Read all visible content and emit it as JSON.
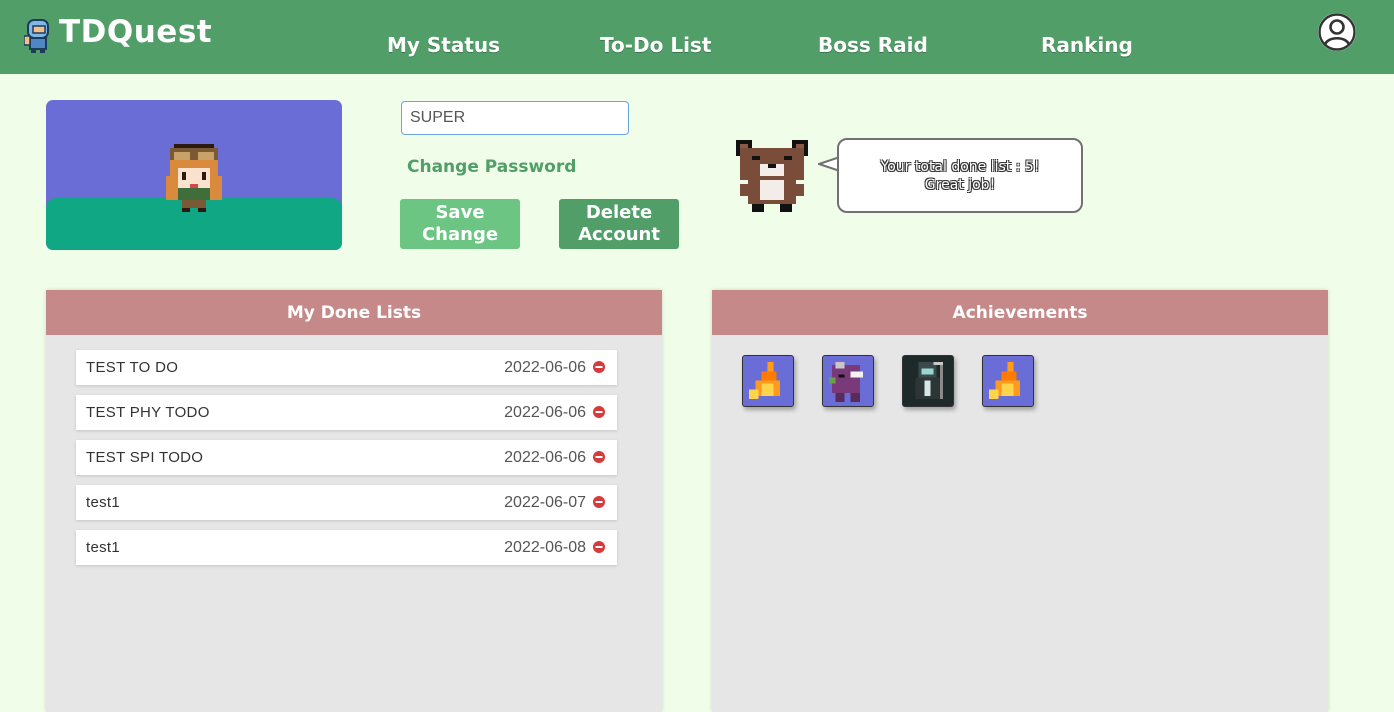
{
  "app": {
    "title": "TDQuest"
  },
  "nav": {
    "items": [
      {
        "label": "My Status"
      },
      {
        "label": "To-Do List"
      },
      {
        "label": "Boss Raid"
      },
      {
        "label": "Ranking"
      }
    ],
    "profile_icon": "user-circle-icon"
  },
  "profile": {
    "nickname_value": "SUPER",
    "change_password_label": "Change Password",
    "save_label": "Save Change",
    "delete_label": "Delete Account"
  },
  "mascot": {
    "message_line1": "Your total done list : 5!",
    "message_line2": "Great job!"
  },
  "done_lists": {
    "header": "My Done Lists",
    "items": [
      {
        "title": "TEST TO DO",
        "date": "2022-06-06"
      },
      {
        "title": "TEST PHY TODO",
        "date": "2022-06-06"
      },
      {
        "title": "TEST SPI TODO",
        "date": "2022-06-06"
      },
      {
        "title": "test1",
        "date": "2022-06-07"
      },
      {
        "title": "test1",
        "date": "2022-06-08"
      }
    ]
  },
  "achievements": {
    "header": "Achievements",
    "badges": [
      {
        "icon": "fire-badge-icon"
      },
      {
        "icon": "dinosaur-badge-icon"
      },
      {
        "icon": "reaper-badge-icon"
      },
      {
        "icon": "fire-badge-icon"
      }
    ]
  },
  "colors": {
    "topbar": "#519e68",
    "background": "#f0fde9",
    "panel_header": "#c58989",
    "save_button": "#6cc582",
    "delete_button": "#519e68"
  }
}
